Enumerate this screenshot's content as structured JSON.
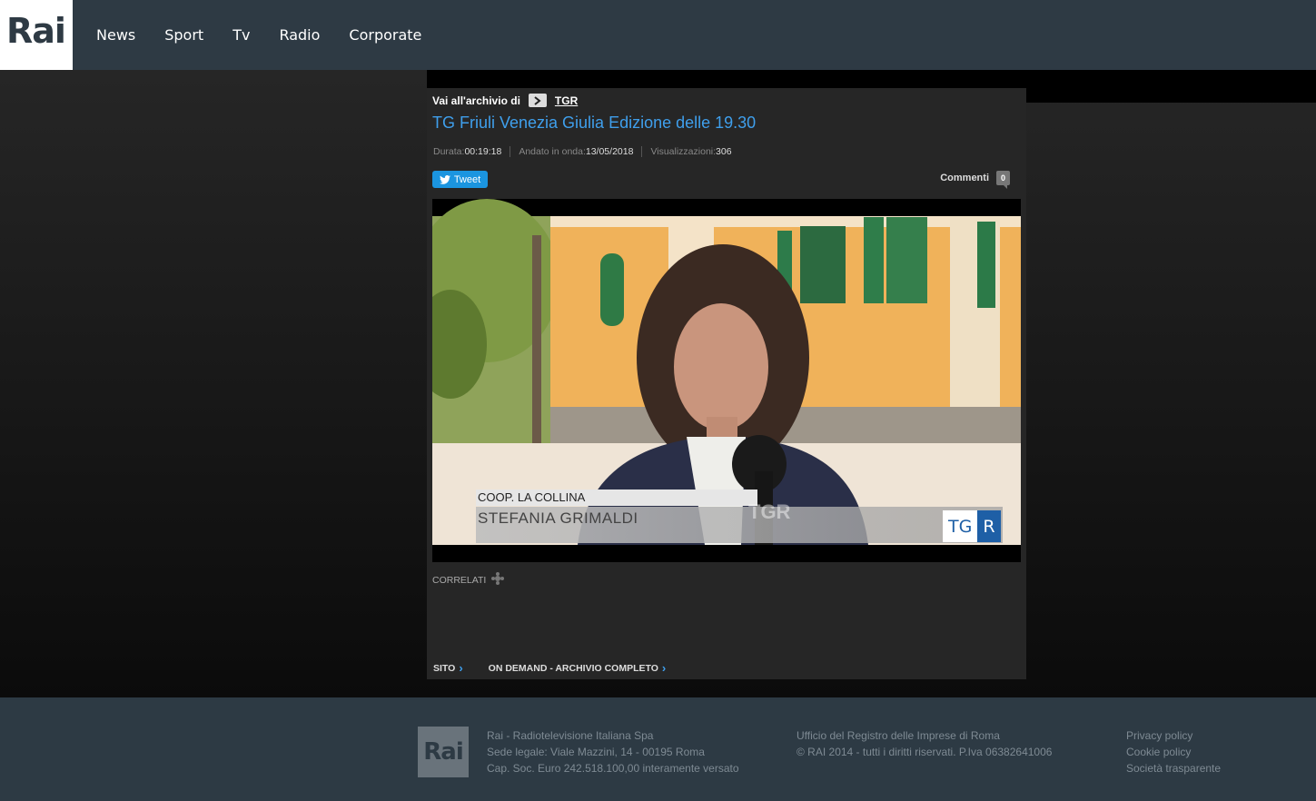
{
  "header": {
    "logo": "Rai",
    "nav": [
      "News",
      "Sport",
      "Tv",
      "Radio",
      "Corporate"
    ]
  },
  "content": {
    "archive_label": "Vai all'archivio di",
    "archive_link": "TGR",
    "title": "TG Friuli Venezia Giulia Edizione delle 19.30",
    "meta": {
      "duration_label": "Durata:",
      "duration": "00:19:18",
      "aired_label": "Andato in onda:",
      "aired": "13/05/2018",
      "views_label": "Visualizzazioni:",
      "views": "306"
    },
    "tweet_label": "Tweet",
    "comments_label": "Commenti",
    "comments_count": "0",
    "video": {
      "caption_top": "COOP. LA COLLINA",
      "caption_name": "STEFANIA GRIMALDI",
      "watermark": "TGR",
      "logo_tg": "TG",
      "logo_r": "R"
    },
    "correlati_label": "CORRELATI",
    "links": [
      "SITO",
      "ON DEMAND - ARCHIVIO COMPLETO"
    ]
  },
  "footer": {
    "logo": "Rai",
    "col1": [
      "Rai - Radiotelevisione Italiana Spa",
      "Sede legale: Viale Mazzini, 14 - 00195 Roma",
      "Cap. Soc. Euro 242.518.100,00 interamente versato"
    ],
    "col2": [
      "Ufficio del Registro delle Imprese di Roma",
      "© RAI 2014 - tutti i diritti riservati. P.Iva 06382641006"
    ],
    "col3": [
      "Privacy policy",
      "Cookie policy",
      "Società trasparente"
    ]
  }
}
